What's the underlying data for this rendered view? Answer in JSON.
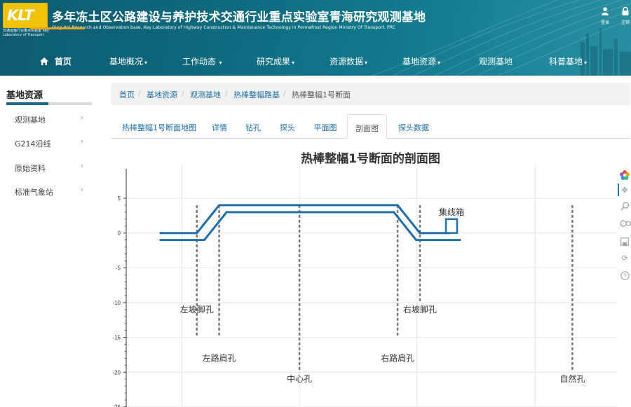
{
  "header": {
    "logo_text": "KLT",
    "logo_caption": "交通运输行业重点实验室 Key Laboratory of Transport",
    "title": "多年冻土区公路建设与养护技术交通行业重点实验室青海研究观测基地",
    "subtitle": "Qing Hai Research and Observation base, Key Laboratory of Highway Construction & Maintenance Technology in Permafrost Region Ministry Of Transport, PRC",
    "login_label": "登录",
    "logout_label": "注销"
  },
  "nav": {
    "items": [
      {
        "label": "首页",
        "has_caret": false,
        "active": true
      },
      {
        "label": "基地概况",
        "has_caret": true
      },
      {
        "label": "工作动态",
        "has_caret": true
      },
      {
        "label": "研究成果",
        "has_caret": true
      },
      {
        "label": "资源数据",
        "has_caret": true
      },
      {
        "label": "基地资源",
        "has_caret": true
      },
      {
        "label": "观测基地",
        "has_caret": false
      },
      {
        "label": "科普基地",
        "has_caret": true
      }
    ],
    "accent_color": "#e8a317"
  },
  "sidebar": {
    "title": "基地资源",
    "items": [
      {
        "label": "观测基地"
      },
      {
        "label": "G214沿线"
      },
      {
        "label": "原始资料"
      },
      {
        "label": "标准气象站"
      }
    ]
  },
  "breadcrumb": {
    "items": [
      "首页",
      "基地资源",
      "观测基地",
      "热棒整幅路基",
      "热棒整幅1号断面"
    ],
    "separator": "/"
  },
  "tabs": {
    "items": [
      "热棒整幅1号断面地图",
      "详情",
      "钻孔",
      "探头",
      "平面图",
      "剖面图",
      "探头数据"
    ],
    "active_index": 5
  },
  "chart_data": {
    "type": "line",
    "title": "热棒整幅1号断面的剖面图",
    "ylim": [
      -25,
      5
    ],
    "yticks": [
      5,
      0,
      -5,
      -10,
      -15,
      -20,
      -25
    ],
    "grid": true,
    "line_color": "#1f6fa8",
    "series": [
      {
        "points": [
          [
            -12.0,
            0
          ],
          [
            -7.0,
            0
          ],
          [
            -4.0,
            4
          ],
          [
            20.0,
            4
          ],
          [
            23.0,
            0
          ],
          [
            27.0,
            0
          ]
        ]
      },
      {
        "points": [
          [
            -12.0,
            -1
          ],
          [
            -6.0,
            -1
          ],
          [
            -3.0,
            3
          ],
          [
            19.5,
            3
          ],
          [
            22.5,
            -1
          ],
          [
            28.5,
            -1
          ]
        ]
      }
    ],
    "box": {
      "label": "集线箱",
      "x": [
        26.5,
        28.0
      ],
      "y": [
        0,
        2
      ]
    },
    "boreholes": [
      {
        "label": "左坡脚孔",
        "x": -7.0,
        "depth": -15
      },
      {
        "label": "左路肩孔",
        "x": -4.0,
        "depth": -15
      },
      {
        "label": "中心孔",
        "x": 6.8,
        "depth": -20
      },
      {
        "label": "右路肩孔",
        "x": 20.0,
        "depth": -15
      },
      {
        "label": "右坡脚孔",
        "x": 23.0,
        "depth": -10
      },
      {
        "label": "自然孔",
        "x": 43.5,
        "depth": -20
      }
    ]
  },
  "toolbar": {
    "tools": [
      "palette-icon",
      "pan-icon",
      "zoom-icon",
      "reset-zoom-icon",
      "save-icon",
      "refresh-icon",
      "help-icon"
    ]
  }
}
